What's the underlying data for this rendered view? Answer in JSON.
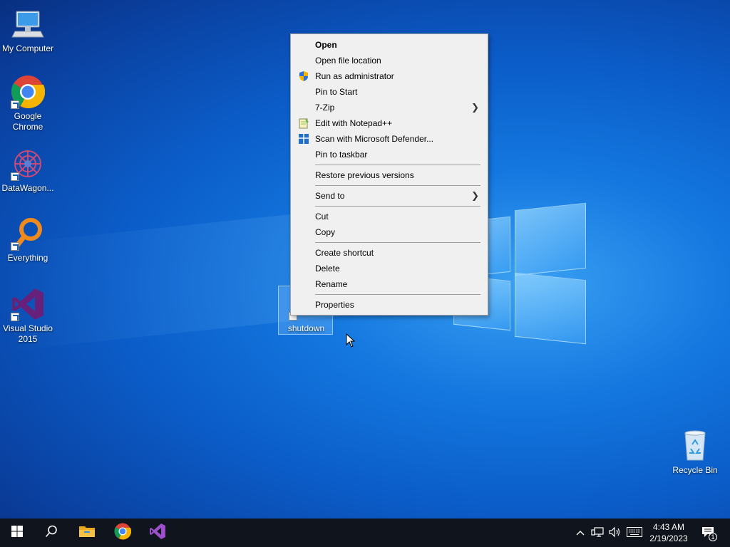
{
  "desktop": {
    "icons": [
      {
        "label": "My Computer"
      },
      {
        "label": "Google Chrome"
      },
      {
        "label": "DataWagon..."
      },
      {
        "label": "Everything"
      },
      {
        "label": "Visual Studio 2015"
      },
      {
        "label": "shutdown"
      },
      {
        "label": "Recycle Bin"
      }
    ]
  },
  "context_menu": {
    "items": [
      {
        "label": "Open",
        "bold": true
      },
      {
        "label": "Open file location"
      },
      {
        "label": "Run as administrator",
        "icon": "shield-icon"
      },
      {
        "label": "Pin to Start"
      },
      {
        "label": "7-Zip",
        "submenu": true
      },
      {
        "label": "Edit with Notepad++",
        "icon": "notepad-plus-plus-icon"
      },
      {
        "label": "Scan with Microsoft Defender...",
        "icon": "defender-icon"
      },
      {
        "label": "Pin to taskbar"
      },
      {
        "label": "Restore previous versions"
      },
      {
        "label": "Send to",
        "submenu": true
      },
      {
        "label": "Cut"
      },
      {
        "label": "Copy"
      },
      {
        "label": "Create shortcut"
      },
      {
        "label": "Delete"
      },
      {
        "label": "Rename"
      },
      {
        "label": "Properties"
      }
    ]
  },
  "taskbar": {
    "pinned": [
      "start-icon",
      "search-icon",
      "file-explorer-icon",
      "chrome-icon",
      "visual-studio-icon"
    ],
    "tray_icons": [
      "chevron-up-icon",
      "network-icon",
      "volume-icon",
      "keyboard-icon"
    ],
    "time": "4:43 AM",
    "date": "2/19/2023",
    "notification_count": "1"
  },
  "colors": {
    "desktop_blue": "#0b5dc9",
    "taskbar": "#10141c",
    "menu_bg": "#f0f0f0",
    "chrome_red": "#db4437",
    "chrome_green": "#0f9d58",
    "chrome_yellow": "#f4b400",
    "chrome_blue": "#4285f4",
    "vs_purple": "#68217a"
  }
}
